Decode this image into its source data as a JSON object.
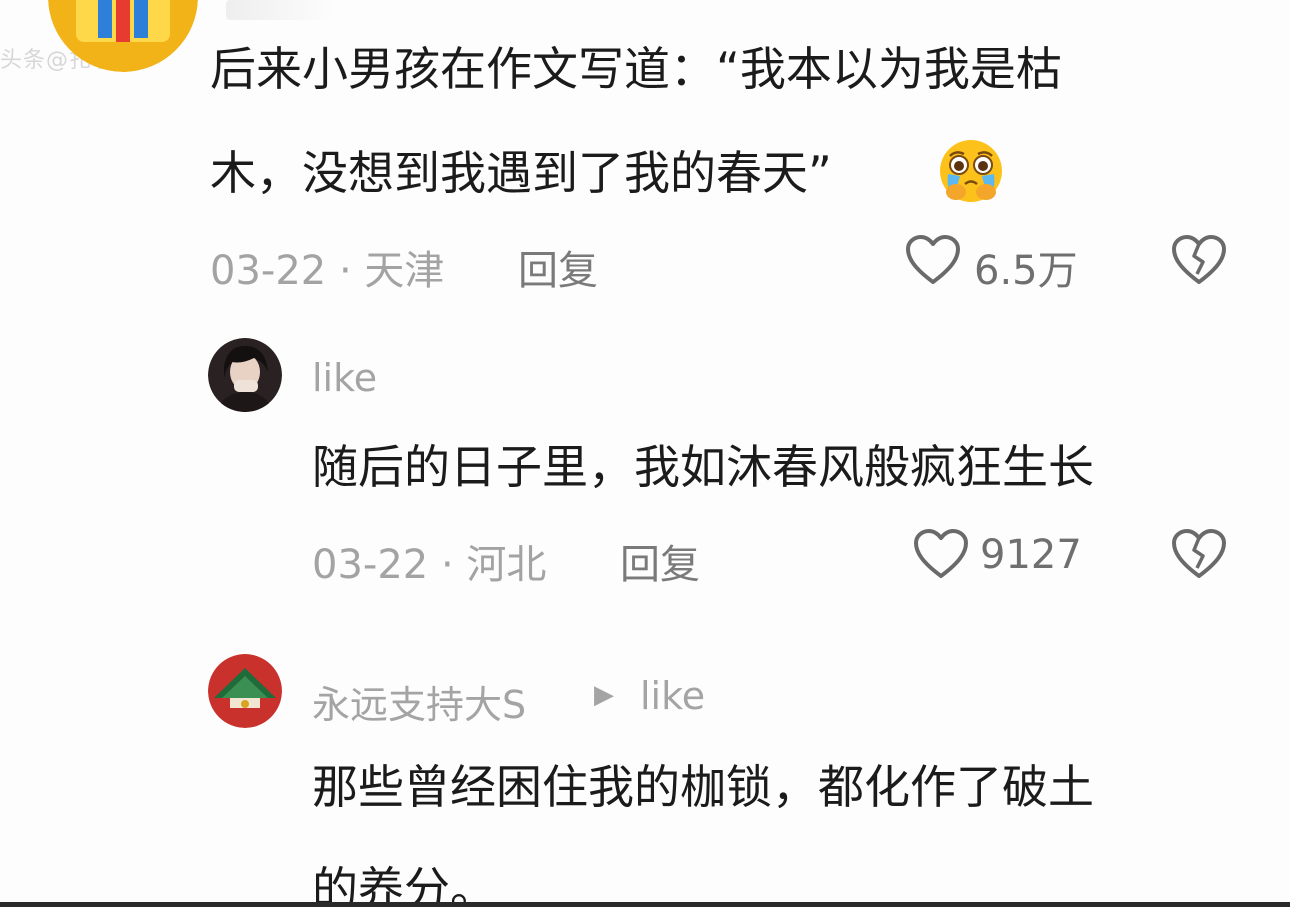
{
  "watermark": "头条@扎小",
  "comments": [
    {
      "line1": "后来小男孩在作文写道：“我本以为我是枯",
      "line2": "木，没想到我遇到了我的春天”",
      "emoji": "crying-face-emoji",
      "date_location": "03-22 · 天津",
      "reply_label": "回复",
      "likes": "6.5万"
    },
    {
      "username": "like",
      "text": "随后的日子里，我如沐春风般疯狂生长",
      "date_location": "03-22 · 河北",
      "reply_label": "回复",
      "likes": "9127"
    },
    {
      "username": "永远支持大S",
      "reply_to": "like",
      "line1": "那些曾经困住我的枷锁，都化作了破土",
      "line2": "的养分。"
    }
  ]
}
